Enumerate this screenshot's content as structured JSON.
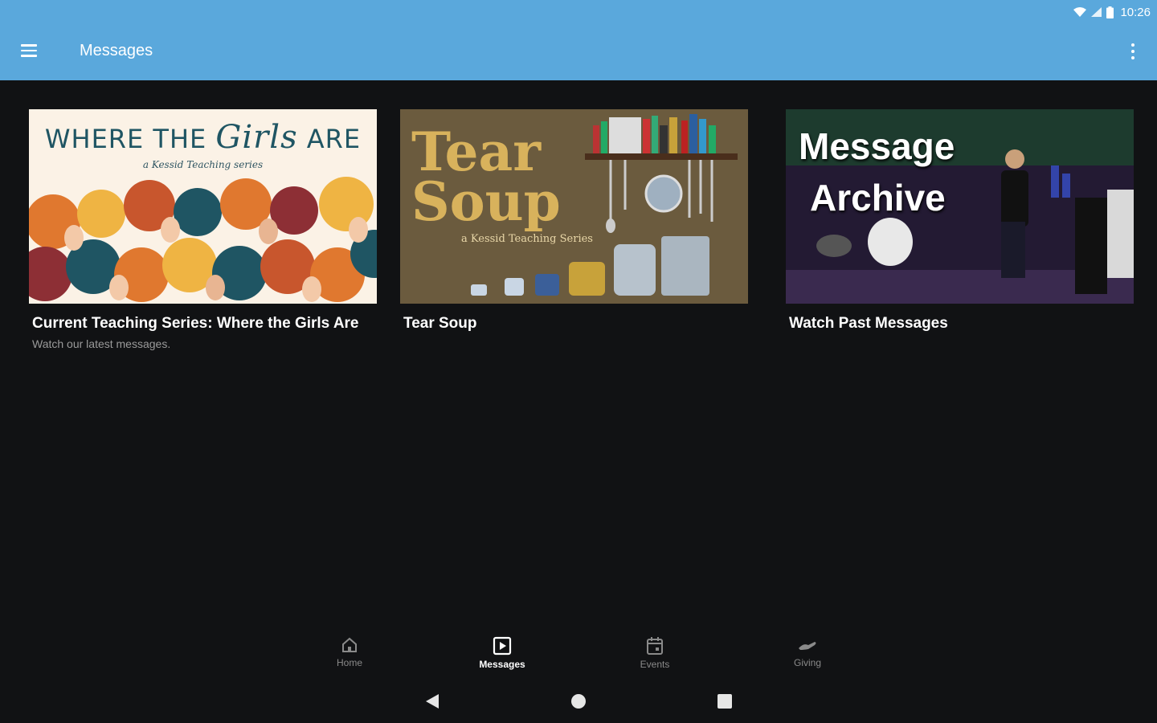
{
  "status_bar": {
    "time": "10:26"
  },
  "app_bar": {
    "title": "Messages"
  },
  "cards": [
    {
      "title": "Current Teaching Series: Where the Girls Are",
      "subtitle": "Watch our latest messages.",
      "thumbnail": {
        "line1": "WHERE THE",
        "accent": "Girls",
        "line1_end": "ARE",
        "tagline": "a Kessid Teaching series"
      }
    },
    {
      "title": "Tear Soup",
      "subtitle": "",
      "thumbnail": {
        "line1": "Tear",
        "line2": "Soup",
        "tagline": "a Kessid Teaching Series"
      }
    },
    {
      "title": "Watch Past Messages",
      "subtitle": "",
      "thumbnail": {
        "line1": "Message",
        "line2": "Archive"
      }
    }
  ],
  "bottom_nav": [
    {
      "label": "Home",
      "icon": "home-icon",
      "active": false
    },
    {
      "label": "Messages",
      "icon": "play-square-icon",
      "active": true
    },
    {
      "label": "Events",
      "icon": "calendar-icon",
      "active": false
    },
    {
      "label": "Giving",
      "icon": "giving-hand-icon",
      "active": false
    }
  ],
  "colors": {
    "app_bar": "#5aa8dc",
    "background": "#111214"
  }
}
